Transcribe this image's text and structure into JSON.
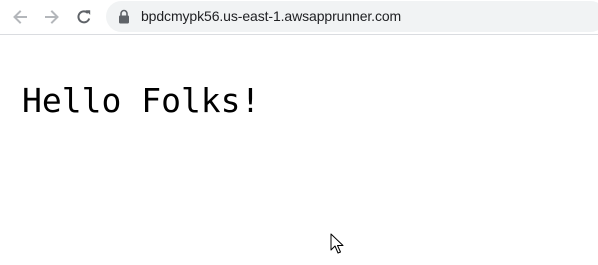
{
  "browser": {
    "url": "bpdcmypk56.us-east-1.awsapprunner.com",
    "icons": {
      "back": "arrow-left-icon",
      "forward": "arrow-right-icon",
      "reload": "reload-icon",
      "secure": "lock-icon"
    },
    "colors": {
      "icon_disabled": "#b4b7bb",
      "icon_active": "#5f6368",
      "omnibox_bg": "#f1f3f4"
    }
  },
  "page": {
    "heading": "Hello Folks!"
  }
}
